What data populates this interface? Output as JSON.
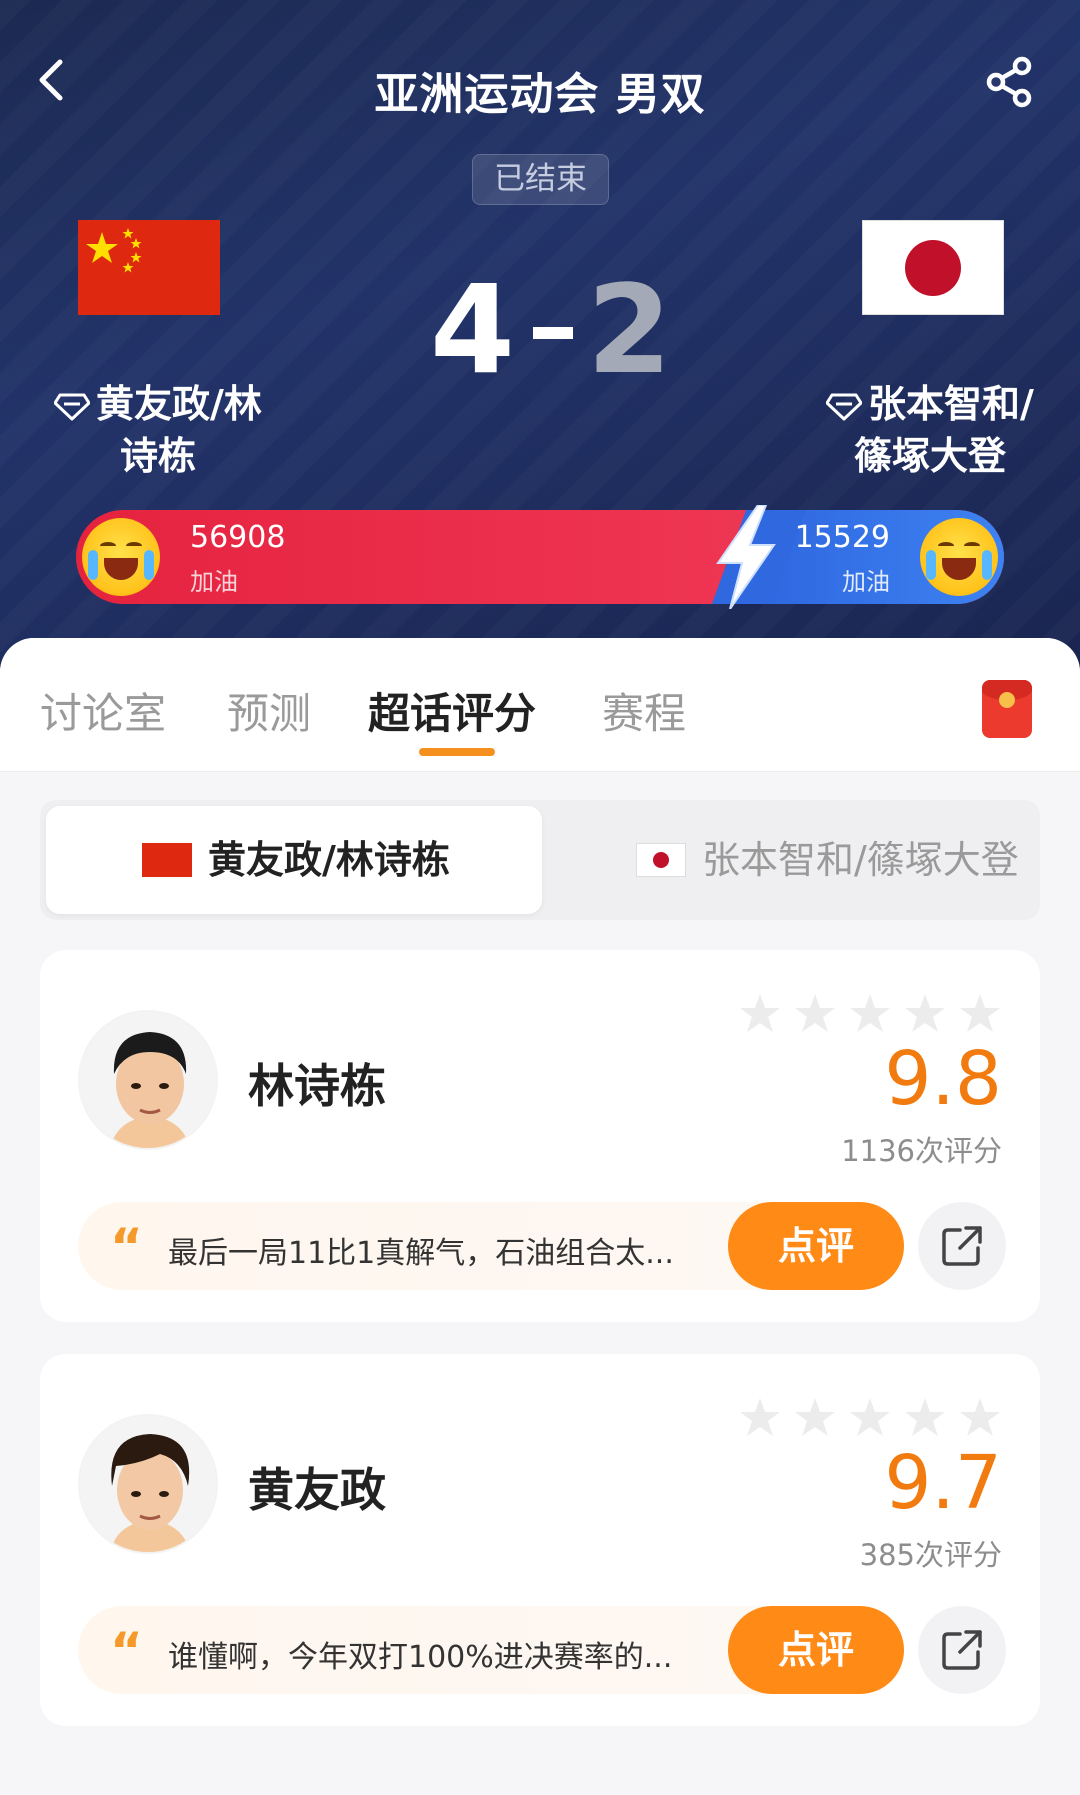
{
  "header": {
    "title": "亚洲运动会 男双",
    "status": "已结束",
    "score_left": "4",
    "score_right": "2",
    "team_left": {
      "name_line1": "黄友政/林",
      "name_line2": "诗栋",
      "flag": "china-flag"
    },
    "team_right": {
      "name_line1": "张本智和/",
      "name_line2": "篠塚大登",
      "flag": "japan-flag"
    },
    "icons": {
      "back": "chevron-left-icon",
      "share": "share-icon"
    }
  },
  "cheer": {
    "left_count": "56908",
    "left_label": "加油",
    "right_count": "15529",
    "right_label": "加油",
    "left_color": "#e5233f",
    "right_color": "#3d82f2"
  },
  "tabs": [
    {
      "label": "讨论室"
    },
    {
      "label": "预测"
    },
    {
      "label": "超话评分"
    },
    {
      "label": "赛程"
    }
  ],
  "segment": {
    "left": "黄友政/林诗栋",
    "right": "张本智和/篠塚大登"
  },
  "players": [
    {
      "name": "林诗栋",
      "rating": "9.8",
      "count": "1136次评分",
      "comment": "最后一局11比1真解气，石油组合太...",
      "button": "点评"
    },
    {
      "name": "黄友政",
      "rating": "9.7",
      "count": "385次评分",
      "comment": "谁懂啊，今年双打100%进决赛率的...",
      "button": "点评"
    }
  ],
  "colors": {
    "accent": "#ff8a16",
    "rating": "#f27b10",
    "header_bg": "#1f2d5c"
  }
}
